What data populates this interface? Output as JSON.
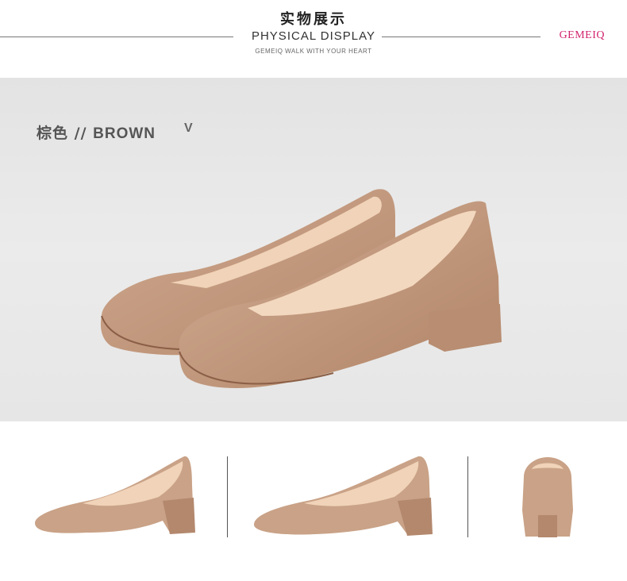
{
  "header": {
    "title_cn": "实物展示",
    "title_en": "PHYSICAL DISPLAY",
    "tagline": "GEMEIQ WALK WITH YOUR HEART",
    "brand": "GEMEIQ"
  },
  "hero": {
    "color_cn": "棕色",
    "separator": "//",
    "color_en": "BROWN",
    "chevron": "V",
    "image": "pair of brown suede pumps"
  },
  "thumbnails": [
    {
      "view": "side view shoe"
    },
    {
      "view": "side view shoe 2"
    },
    {
      "view": "back view shoe"
    }
  ],
  "colors": {
    "brand": "#d2236e",
    "suede": "#c49a80",
    "suede_dark": "#a9795f",
    "lining": "#f0d3b8",
    "background": "#e6e6e6"
  }
}
